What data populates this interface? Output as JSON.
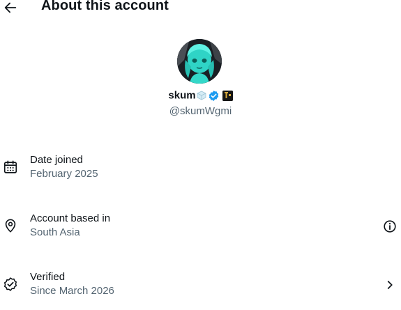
{
  "header": {
    "back_icon": "arrow-left-icon",
    "title": "About this account"
  },
  "profile": {
    "display_name": "skum",
    "name_emoji_icon": "ice-cube-icon",
    "verified_icon": "verified-badge-icon",
    "affiliate_icon": "affiliate-badge-icon",
    "handle": "@skumWgmi"
  },
  "details": [
    {
      "icon": "calendar-icon",
      "label": "Date joined",
      "value": "February 2025"
    },
    {
      "icon": "location-pin-icon",
      "label": "Account based in",
      "value": "South Asia",
      "action_icon": "info-icon"
    },
    {
      "icon": "verified-check-icon",
      "label": "Verified",
      "value": "Since March 2026",
      "action_icon": "chevron-right-icon"
    }
  ],
  "colors": {
    "text_primary": "#0f1419",
    "text_secondary": "#536471",
    "verified_blue": "#1d9bf0",
    "avatar_accent": "#3fe0d0"
  }
}
